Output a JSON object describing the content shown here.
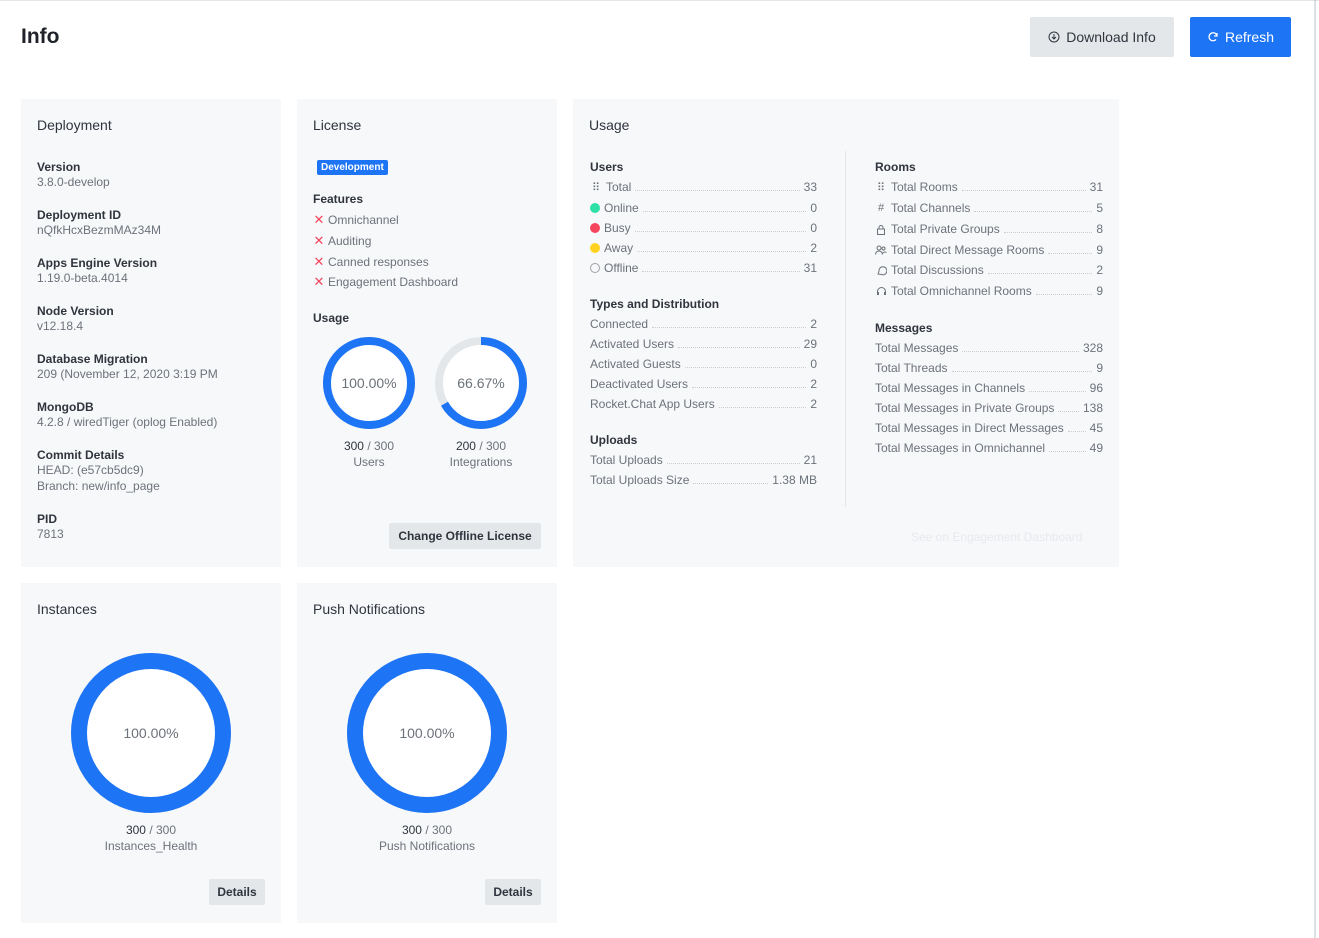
{
  "header": {
    "title": "Info",
    "download_label": "Download Info",
    "refresh_label": "Refresh"
  },
  "colors": {
    "primary": "#1d74f5",
    "card_bg": "#f7f8fa",
    "online": "#2de0a5",
    "busy": "#f5455c",
    "away": "#ffd21f",
    "error": "#f5455c"
  },
  "deployment": {
    "title": "Deployment",
    "items": [
      {
        "label": "Version",
        "value": "3.8.0-develop"
      },
      {
        "label": "Deployment ID",
        "value": "nQfkHcxBezmMAz34M"
      },
      {
        "label": "Apps Engine Version",
        "value": "1.19.0-beta.4014"
      },
      {
        "label": "Node Version",
        "value": "v12.18.4"
      },
      {
        "label": "Database Migration",
        "value": "209 (November 12, 2020 3:19 PM"
      },
      {
        "label": "MongoDB",
        "value": "4.2.8 / wiredTiger (oplog Enabled)"
      },
      {
        "label": "Commit Details",
        "value": "HEAD: (e57cb5dc9)",
        "value2": "Branch: new/info_page"
      },
      {
        "label": "PID",
        "value": "7813"
      }
    ]
  },
  "license": {
    "title": "License",
    "badge": "Development",
    "features_label": "Features",
    "features": [
      "Omnichannel",
      "Auditing",
      "Canned responses",
      "Engagement Dashboard"
    ],
    "usage_label": "Usage",
    "donuts": [
      {
        "percent_text": "100.00%",
        "fraction": 1.0,
        "used": "300",
        "total": "300",
        "caption": "Users"
      },
      {
        "percent_text": "66.67%",
        "fraction": 0.6667,
        "used": "200",
        "total": "300",
        "caption": "Integrations"
      }
    ],
    "change_button": "Change Offline License"
  },
  "usage": {
    "title": "Usage",
    "users": {
      "label": "Users",
      "rows": [
        {
          "icon": "team-icon",
          "label": "Total",
          "value": "33"
        },
        {
          "icon": "online-status-icon",
          "label": "Online",
          "value": "0"
        },
        {
          "icon": "busy-status-icon",
          "label": "Busy",
          "value": "0"
        },
        {
          "icon": "away-status-icon",
          "label": "Away",
          "value": "2"
        },
        {
          "icon": "offline-status-icon",
          "label": "Offline",
          "value": "31"
        }
      ]
    },
    "types": {
      "label": "Types and Distribution",
      "rows": [
        {
          "label": "Connected",
          "value": "2"
        },
        {
          "label": "Activated Users",
          "value": "29"
        },
        {
          "label": "Activated Guests",
          "value": "0"
        },
        {
          "label": "Deactivated Users",
          "value": "2"
        },
        {
          "label": "Rocket.Chat App Users",
          "value": "2"
        }
      ]
    },
    "uploads": {
      "label": "Uploads",
      "rows": [
        {
          "label": "Total Uploads",
          "value": "21"
        },
        {
          "label": "Total Uploads Size",
          "value": "1.38 MB"
        }
      ]
    },
    "rooms": {
      "label": "Rooms",
      "rows": [
        {
          "icon": "rooms-grid-icon",
          "label": "Total Rooms",
          "value": "31"
        },
        {
          "icon": "hashtag-icon",
          "label": "Total Channels",
          "value": "5"
        },
        {
          "icon": "lock-icon",
          "label": "Total Private Groups",
          "value": "8"
        },
        {
          "icon": "team-icon",
          "label": "Total Direct Message Rooms",
          "value": "9"
        },
        {
          "icon": "discussion-icon",
          "label": "Total Discussions",
          "value": "2"
        },
        {
          "icon": "headset-icon",
          "label": "Total Omnichannel Rooms",
          "value": "9"
        }
      ]
    },
    "messages": {
      "label": "Messages",
      "rows": [
        {
          "label": "Total Messages",
          "value": "328"
        },
        {
          "label": "Total Threads",
          "value": "9"
        },
        {
          "label": "Total Messages in Channels",
          "value": "96"
        },
        {
          "label": "Total Messages in Private Groups",
          "value": "138"
        },
        {
          "label": "Total Messages in Direct Messages",
          "value": "45"
        },
        {
          "label": "Total Messages in Omnichannel",
          "value": "49"
        }
      ]
    },
    "engagement_link": "See on Engagement Dashboard"
  },
  "instances": {
    "title": "Instances",
    "percent_text": "100.00%",
    "fraction": 1.0,
    "used": "300",
    "total": "300",
    "caption": "Instances_Health",
    "details_button": "Details"
  },
  "push": {
    "title": "Push Notifications",
    "percent_text": "100.00%",
    "fraction": 1.0,
    "used": "300",
    "total": "300",
    "caption": "Push Notifications",
    "details_button": "Details"
  }
}
